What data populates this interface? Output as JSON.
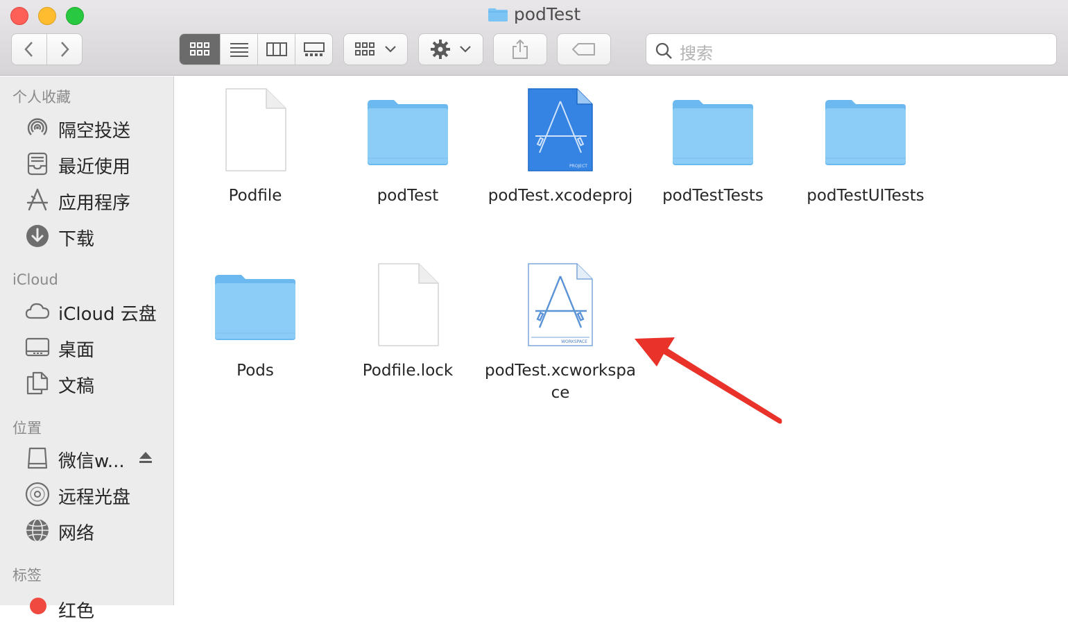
{
  "window": {
    "title": "podTest"
  },
  "toolbar": {
    "search_placeholder": "搜索"
  },
  "sidebar": {
    "sections": [
      {
        "heading": "个人收藏",
        "items": [
          {
            "label": "隔空投送",
            "icon": "airdrop-icon"
          },
          {
            "label": "最近使用",
            "icon": "recents-icon"
          },
          {
            "label": "应用程序",
            "icon": "applications-icon"
          },
          {
            "label": "下载",
            "icon": "downloads-icon"
          }
        ]
      },
      {
        "heading": "iCloud",
        "items": [
          {
            "label": "iCloud 云盘",
            "icon": "cloud-icon"
          },
          {
            "label": "桌面",
            "icon": "desktop-icon"
          },
          {
            "label": "文稿",
            "icon": "documents-icon"
          }
        ]
      },
      {
        "heading": "位置",
        "items": [
          {
            "label": "微信w...",
            "icon": "disk-icon"
          },
          {
            "label": "远程光盘",
            "icon": "cd-icon"
          },
          {
            "label": "网络",
            "icon": "network-icon"
          }
        ]
      },
      {
        "heading": "标签",
        "items": [
          {
            "label": "红色",
            "icon": "red-tag-icon"
          }
        ]
      }
    ]
  },
  "files": [
    {
      "name": "Podfile",
      "kind": "document"
    },
    {
      "name": "podTest",
      "kind": "folder"
    },
    {
      "name": "podTest.xcodeproj",
      "kind": "xcodeproj"
    },
    {
      "name": "podTestTests",
      "kind": "folder"
    },
    {
      "name": "podTestUITests",
      "kind": "folder"
    },
    {
      "name": "Pods",
      "kind": "folder"
    },
    {
      "name": "Podfile.lock",
      "kind": "document"
    },
    {
      "name": "podTest.xcworkspace",
      "kind": "xcworkspace"
    }
  ],
  "icon_labels": {
    "project": "PROJECT",
    "workspace": "WORKSPACE"
  },
  "colors": {
    "folder": "#7cc4f4",
    "arrow": "#e8322a",
    "xcode_blue": "#2f7ee0"
  }
}
